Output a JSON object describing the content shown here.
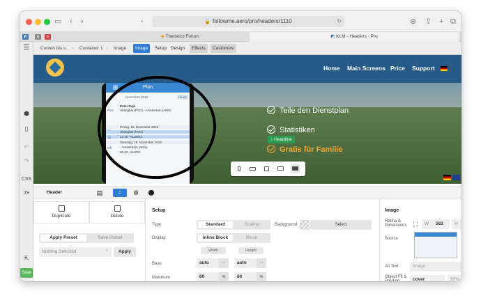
{
  "browser": {
    "url": "followme.aero/pro/headers/1110",
    "tabs": [
      {
        "label": "Themeco Forum"
      },
      {
        "label": "KLM - Headers - Pro"
      }
    ]
  },
  "breadcrumbs": [
    "Conten bis s...",
    "Container 1",
    "Image"
  ],
  "modes": [
    "Image",
    "Setup",
    "Design",
    "Effects",
    "Customize"
  ],
  "rail": {
    "css": "CSS",
    "js": "JS",
    "save": "Save"
  },
  "site_nav": [
    "Home",
    "Main Screens",
    "Price",
    "Support"
  ],
  "features": [
    "Teile den Dienstplan",
    "Statistiken",
    "Gratis für Familie"
  ],
  "headline_tag": "Headline",
  "phone": {
    "title": "Plan",
    "today": "Heute",
    "month": "November 2019",
    "name": "Peter Dejk",
    "route1": "Shanghai (PVG) - Amsterdam (AMS)",
    "plan": "Plan",
    "row_prolog": "Prolog, 15. November 2019",
    "row_shanghai": "Shanghai (PVG) -",
    "row_time": "17:10 - KLBR14",
    "row_samstag": "Samstag, 16. November 2019",
    "row_ams": "- Amsterdam (AMS)",
    "row_ams_time": "06:30 - KLBR4",
    "off": "Off",
    "sa": "Sa",
    "day": "16"
  },
  "panel": {
    "header_tab": "Header",
    "duplicate": "Duplicate",
    "delete": "Delete",
    "apply_preset": "Apply Preset",
    "save_preset": "Save Preset",
    "nothing_selected": "Nothing Selected",
    "apply": "Apply"
  },
  "setup": {
    "title": "Setup",
    "type_label": "Type",
    "type_on": "Standard",
    "type_off": "Scaling",
    "display_label": "Display",
    "display_on": "Inline Block",
    "display_off": "Block",
    "width_head": "Width",
    "height_head": "Height",
    "base_label": "Base",
    "base_width": "auto",
    "base_height": "auto",
    "max_label": "Maximum",
    "max_width": "60",
    "max_width_unit": "%",
    "max_height": "60",
    "max_height_unit": "%",
    "background_label": "Background",
    "select": "Select",
    "dots": "···"
  },
  "image": {
    "title": "Image",
    "retina_label": "Retina & Dimensions",
    "w_label": "W",
    "w_value": "563",
    "h_label": "H",
    "h_value": "460",
    "source_label": "Source",
    "alt_label": "Alt Text",
    "alt_placeholder": "Image",
    "fit_label": "Object Fit & Position",
    "fit_value": "cover",
    "position_value": "50% 50%"
  },
  "colors": {
    "accent": "#2d7cd6",
    "nav_bg": "#265a87",
    "headline_green": "#2e9b52",
    "feature_gold": "#f6a830",
    "save_green": "#5bb85c"
  }
}
